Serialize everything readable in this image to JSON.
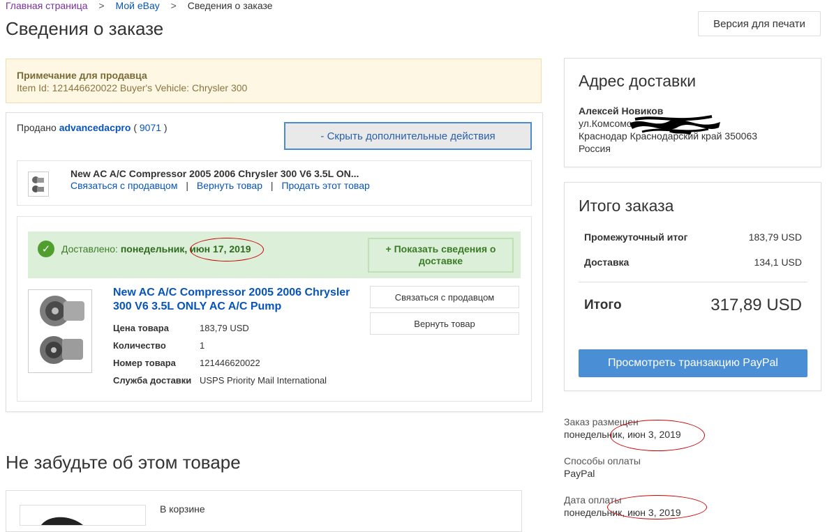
{
  "breadcrumb": {
    "home": "Главная страница",
    "my_ebay": "Мой eBay",
    "current": "Сведения о заказе",
    "separator": ">"
  },
  "page_title": "Сведения о заказе",
  "print_button": "Версия для печати",
  "seller_note": {
    "title": "Примечание для продавца",
    "text": "Item Id: 121446620022 Buyer's Vehicle: Chrysler 300"
  },
  "sold_by": {
    "prefix": "Продано",
    "seller": "advancedacpro",
    "open_paren": "(",
    "score": "9071",
    "close_paren": ")"
  },
  "hide_actions_button": "- Скрыть дополнительные действия",
  "item_strip": {
    "title": "New AC A/C Compressor 2005 2006 Chrysler 300 V6 3.5L ON...",
    "actions": [
      "Связаться с продавцом",
      "Вернуть товар",
      "Продать этот товар"
    ],
    "pipe": "|"
  },
  "delivery": {
    "label": "Доставлено:",
    "date": "понедельник, июн 17, 2019",
    "show_details_button": "+ Показать сведения о доставке"
  },
  "item": {
    "title": "New AC A/C Compressor 2005 2006 Chrysler 300 V6 3.5L ONLY AC A/C Pump",
    "details": [
      {
        "label": "Цена товара",
        "value": "183,79 USD"
      },
      {
        "label": "Количество",
        "value": "1"
      },
      {
        "label": "Номер товара",
        "value": "121446620022"
      },
      {
        "label": "Служба доставки",
        "value": "USPS Priority Mail International"
      }
    ],
    "contact_button": "Связаться с продавцом",
    "return_button": "Вернуть товар"
  },
  "shipping_address": {
    "heading": "Адрес доставки",
    "name": "Алексей Новиков",
    "line1": "ул.Комсомо",
    "line2": "Краснодар Краснодарский край 350063",
    "country": "Россия"
  },
  "order_total": {
    "heading": "Итого заказа",
    "subtotal_label": "Промежуточный итог",
    "subtotal_value": "183,79 USD",
    "shipping_label": "Доставка",
    "shipping_value": "134,1 USD",
    "total_label": "Итого",
    "total_value": "317,89 USD",
    "paypal_button": "Просмотреть транзакцию PayPal"
  },
  "order_meta": {
    "placed_label": "Заказ размещен",
    "placed_value": "понедельник, июн 3, 2019",
    "payment_methods_label": "Способы оплаты",
    "payment_methods_value": "PayPal",
    "payment_date_label": "Дата оплаты",
    "payment_date_value": "понедельник, июн 3, 2019"
  },
  "reminder": {
    "heading": "Не забудьте об этом товаре",
    "cart_label": "В корзине"
  },
  "colors": {
    "link": "#0654ba",
    "delivered_green": "#4f9e2e",
    "paypal_blue": "#4a8fd6",
    "annotation_red": "#cc0000"
  }
}
